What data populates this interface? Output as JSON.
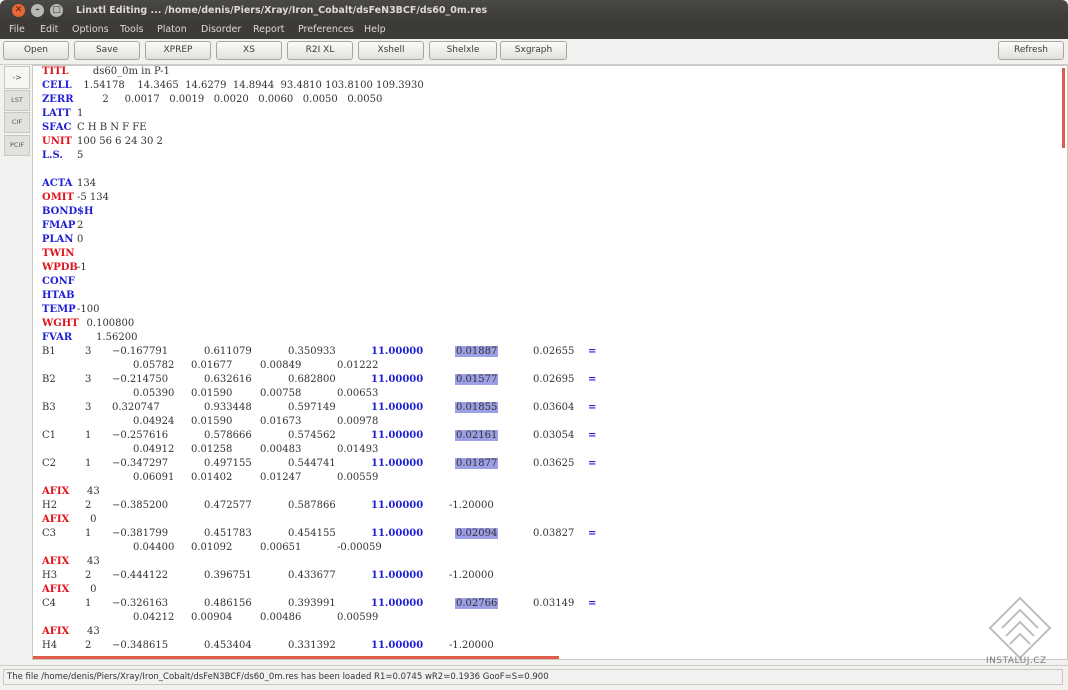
{
  "window": {
    "title": "Linxtl Editing ... /home/denis/Piers/Xray/Iron_Cobalt/dsFeN3BCF/ds60_0m.res",
    "close_glyph": "✕",
    "min_glyph": "–",
    "max_glyph": "□"
  },
  "menu": [
    "File",
    "Edit",
    "Options",
    "Tools",
    "Platon",
    "Disorder",
    "Report",
    "Preferences",
    "Help"
  ],
  "toolbar": [
    "Open",
    "Save",
    "XPREP",
    "XS",
    "R2I XL",
    "Xshell",
    "Shelxle",
    "Sxgraph"
  ],
  "refresh_label": "Refresh",
  "side_tabs": [
    "->",
    "LST",
    "CIF",
    "PCIF"
  ],
  "colors": {
    "red": "#e0141e",
    "blue": "#1f1fd6",
    "highlight": "#9c9ee6",
    "scroll": "#e05d4a"
  },
  "editor": {
    "header_lines": [
      {
        "kw": "TITL",
        "color": "red",
        "rest": "     ds60_0m in P-1"
      },
      {
        "kw": "CELL",
        "color": "blue",
        "rest": "  1.54178    14.3465  14.6279  14.8944  93.4810 103.8100 109.3930"
      },
      {
        "kw": "ZERR",
        "color": "blue",
        "rest": "        2     0.0017   0.0019   0.0020   0.0060   0.0050   0.0050"
      },
      {
        "kw": "LATT",
        "color": "blue",
        "rest": "1"
      },
      {
        "kw": "SFAC",
        "color": "blue",
        "rest": "C H B N F FE"
      },
      {
        "kw": "UNIT",
        "color": "red",
        "rest": "100 56 6 24 30 2"
      },
      {
        "kw": "L.S.",
        "color": "blue",
        "rest": "5"
      },
      {
        "kw": "",
        "color": "blue",
        "rest": ""
      },
      {
        "kw": "ACTA",
        "color": "blue",
        "rest": "134"
      },
      {
        "kw": "OMIT",
        "color": "red",
        "rest": "-5 134"
      },
      {
        "kw": "BOND",
        "color": "blue",
        "rest": "$H",
        "rest_bold_blue": true
      },
      {
        "kw": "FMAP",
        "color": "blue",
        "rest": "2"
      },
      {
        "kw": "PLAN",
        "color": "blue",
        "rest": "0"
      },
      {
        "kw": "TWIN",
        "color": "red",
        "rest": ""
      },
      {
        "kw": "WPDB",
        "color": "red",
        "rest": "-1"
      },
      {
        "kw": "CONF",
        "color": "blue",
        "rest": ""
      },
      {
        "kw": "HTAB",
        "color": "blue",
        "rest": ""
      },
      {
        "kw": "TEMP",
        "color": "blue",
        "rest": "-100"
      },
      {
        "kw": "WGHT",
        "color": "red",
        "rest": "   0.100800"
      },
      {
        "kw": "FVAR",
        "color": "blue",
        "rest": "      1.56200"
      }
    ],
    "atom_lines": [
      {
        "type": "atom",
        "name": "B1",
        "sfac": "3",
        "x": "−0.167791",
        "y": "0.611079",
        "z": "0.350933",
        "occ": "11.00000",
        "u": "0.01887",
        "u_hl": true,
        "u22": "0.02655",
        "eq": "="
      },
      {
        "type": "cont",
        "vals": [
          "0.05782",
          "0.01677",
          "0.00849",
          "0.01222"
        ]
      },
      {
        "type": "atom",
        "name": "B2",
        "sfac": "3",
        "x": "−0.214750",
        "y": "0.632616",
        "z": "0.682800",
        "occ": "11.00000",
        "u": "0.01577",
        "u_hl": true,
        "u22": "0.02695",
        "eq": "="
      },
      {
        "type": "cont",
        "vals": [
          "0.05390",
          "0.01590",
          "0.00758",
          "0.00653"
        ]
      },
      {
        "type": "atom",
        "name": "B3",
        "sfac": "3",
        "x": "0.320747",
        "y": "0.933448",
        "z": "0.597149",
        "occ": "11.00000",
        "u": "0.01855",
        "u_hl": true,
        "u22": "0.03604",
        "eq": "="
      },
      {
        "type": "cont",
        "vals": [
          "0.04924",
          "0.01590",
          "0.01673",
          "0.00978"
        ]
      },
      {
        "type": "atom",
        "name": "C1",
        "sfac": "1",
        "x": "−0.257616",
        "y": "0.578666",
        "z": "0.574562",
        "occ": "11.00000",
        "u": "0.02161",
        "u_hl": true,
        "u22": "0.03054",
        "eq": "="
      },
      {
        "type": "cont",
        "vals": [
          "0.04912",
          "0.01258",
          "0.00483",
          "0.01493"
        ]
      },
      {
        "type": "atom",
        "name": "C2",
        "sfac": "1",
        "x": "−0.347297",
        "y": "0.497155",
        "z": "0.544741",
        "occ": "11.00000",
        "u": "0.01877",
        "u_hl": true,
        "u22": "0.03625",
        "eq": "="
      },
      {
        "type": "cont",
        "vals": [
          "0.06091",
          "0.01402",
          "0.01247",
          "0.00559"
        ]
      },
      {
        "type": "afix",
        "rest": "43"
      },
      {
        "type": "atom",
        "name": "H2",
        "sfac": "2",
        "x": "−0.385200",
        "y": "0.472577",
        "z": "0.587866",
        "occ": "11.00000",
        "u": "-1.20000",
        "u_hl": false,
        "u22": "",
        "eq": ""
      },
      {
        "type": "afix",
        "rest": " 0"
      },
      {
        "type": "atom",
        "name": "C3",
        "sfac": "1",
        "x": "−0.381799",
        "y": "0.451783",
        "z": "0.454155",
        "occ": "11.00000",
        "u": "0.02094",
        "u_hl": true,
        "u22": "0.03827",
        "eq": "="
      },
      {
        "type": "cont",
        "vals": [
          "0.04400",
          "0.01092",
          "0.00651",
          "-0.00059"
        ]
      },
      {
        "type": "afix",
        "rest": "43"
      },
      {
        "type": "atom",
        "name": "H3",
        "sfac": "2",
        "x": "−0.444122",
        "y": "0.396751",
        "z": "0.433677",
        "occ": "11.00000",
        "u": "-1.20000",
        "u_hl": false,
        "u22": "",
        "eq": ""
      },
      {
        "type": "afix",
        "rest": " 0"
      },
      {
        "type": "atom",
        "name": "C4",
        "sfac": "1",
        "x": "−0.326163",
        "y": "0.486156",
        "z": "0.393991",
        "occ": "11.00000",
        "u": "0.02766",
        "u_hl": true,
        "u22": "0.03149",
        "eq": "="
      },
      {
        "type": "cont",
        "vals": [
          "0.04212",
          "0.00904",
          "0.00486",
          "0.00599"
        ]
      },
      {
        "type": "afix",
        "rest": "43"
      },
      {
        "type": "atom",
        "name": "H4",
        "sfac": "2",
        "x": "−0.348615",
        "y": "0.453404",
        "z": "0.331392",
        "occ": "11.00000",
        "u": "-1.20000",
        "u_hl": false,
        "u22": "",
        "eq": ""
      }
    ]
  },
  "watermark": "INSTALUJ.CZ",
  "status": "The file /home/denis/Piers/Xray/Iron_Cobalt/dsFeN3BCF/ds60_0m.res has been loaded R1=0.0745  wR2=0.1936  GooF=S=0.900"
}
